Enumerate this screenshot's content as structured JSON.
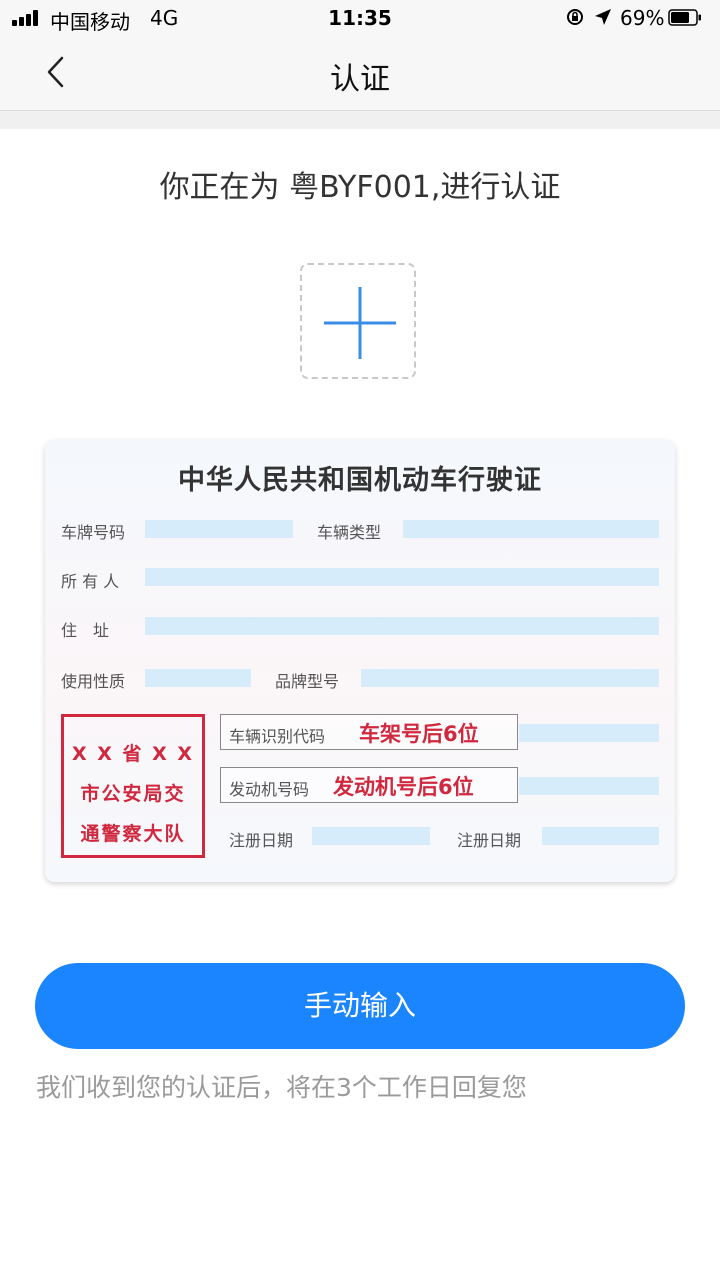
{
  "status_bar": {
    "carrier": "中国移动",
    "network": "4G",
    "time": "11:35",
    "battery": "69%",
    "icons": [
      "signal-icon",
      "rotation-lock-icon",
      "location-icon",
      "battery-icon"
    ]
  },
  "nav": {
    "title": "认证",
    "back_icon": "chevron-left-icon"
  },
  "hint": "你正在为 粤BYF001,进行认证",
  "upload": {
    "icon": "plus-icon",
    "accent": "#3a8ee6"
  },
  "license_card": {
    "title": "中华人民共和国机动车行驶证",
    "plate_label": "车牌号码",
    "vehicle_type_label": "车辆类型",
    "owner_label": "所 有 人",
    "address_label": "住　址",
    "usage_label": "使用性质",
    "model_label": "品牌型号",
    "vin_label": "车辆识别代码",
    "vin_hint": "车架号后6位",
    "engine_label": "发动机号码",
    "engine_hint": "发动机号后6位",
    "register_label": "注册日期",
    "issue_label": "注册日期",
    "stamp_lines": [
      "X X 省 X X",
      "市公安局交",
      "通警察大队"
    ],
    "stamp_color": "#d0283e"
  },
  "manual_button": {
    "label": "手动输入",
    "color": "#1b85ff"
  },
  "footnote": "我们收到您的认证后，将在3个工作日回复您"
}
